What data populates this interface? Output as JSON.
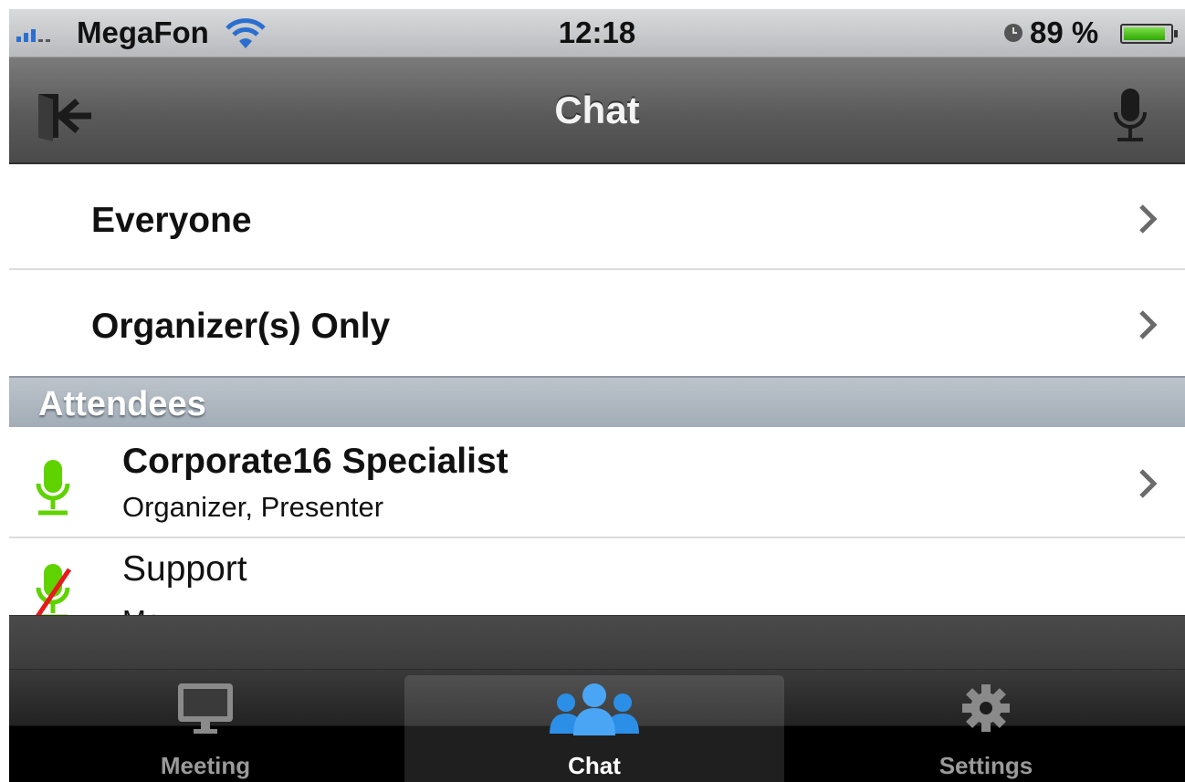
{
  "status_bar": {
    "carrier": "MegaFon",
    "time": "12:18",
    "battery_percent": "89 %",
    "battery_level": 0.89
  },
  "nav": {
    "title": "Chat"
  },
  "list": {
    "everyone_label": "Everyone",
    "organizers_label": "Organizer(s) Only",
    "section_header": "Attendees",
    "attendees": [
      {
        "name": "Corporate16 Specialist",
        "role": "Organizer, Presenter",
        "mic_state": "active"
      },
      {
        "name": "Support",
        "role": "Me",
        "mic_state": "muted"
      }
    ]
  },
  "tabs": [
    {
      "label": "Meeting",
      "icon": "monitor-icon",
      "active": false
    },
    {
      "label": "Chat",
      "icon": "people-icon",
      "active": true
    },
    {
      "label": "Settings",
      "icon": "gear-icon",
      "active": false
    }
  ],
  "colors": {
    "mic_green": "#5fd300",
    "mute_red": "#e8191b",
    "chat_blue": "#2b8fe8"
  }
}
